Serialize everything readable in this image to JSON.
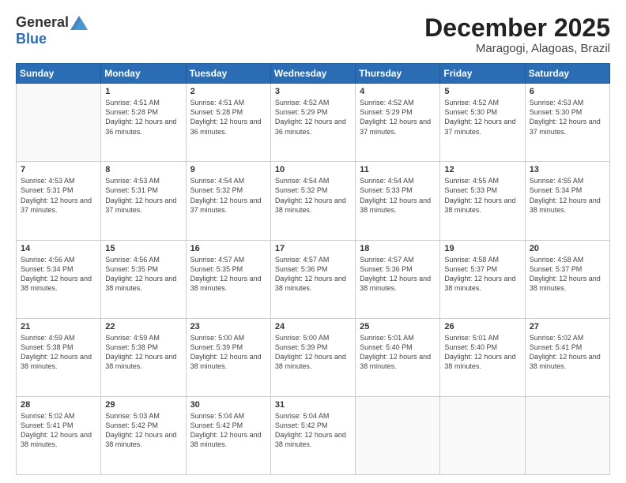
{
  "logo": {
    "general": "General",
    "blue": "Blue"
  },
  "title": {
    "month": "December 2025",
    "location": "Maragogi, Alagoas, Brazil"
  },
  "header": {
    "days": [
      "Sunday",
      "Monday",
      "Tuesday",
      "Wednesday",
      "Thursday",
      "Friday",
      "Saturday"
    ]
  },
  "weeks": [
    [
      {
        "day": "",
        "sunrise": "",
        "sunset": "",
        "daylight": ""
      },
      {
        "day": "1",
        "sunrise": "Sunrise: 4:51 AM",
        "sunset": "Sunset: 5:28 PM",
        "daylight": "Daylight: 12 hours and 36 minutes."
      },
      {
        "day": "2",
        "sunrise": "Sunrise: 4:51 AM",
        "sunset": "Sunset: 5:28 PM",
        "daylight": "Daylight: 12 hours and 36 minutes."
      },
      {
        "day": "3",
        "sunrise": "Sunrise: 4:52 AM",
        "sunset": "Sunset: 5:29 PM",
        "daylight": "Daylight: 12 hours and 36 minutes."
      },
      {
        "day": "4",
        "sunrise": "Sunrise: 4:52 AM",
        "sunset": "Sunset: 5:29 PM",
        "daylight": "Daylight: 12 hours and 37 minutes."
      },
      {
        "day": "5",
        "sunrise": "Sunrise: 4:52 AM",
        "sunset": "Sunset: 5:30 PM",
        "daylight": "Daylight: 12 hours and 37 minutes."
      },
      {
        "day": "6",
        "sunrise": "Sunrise: 4:53 AM",
        "sunset": "Sunset: 5:30 PM",
        "daylight": "Daylight: 12 hours and 37 minutes."
      }
    ],
    [
      {
        "day": "7",
        "sunrise": "Sunrise: 4:53 AM",
        "sunset": "Sunset: 5:31 PM",
        "daylight": "Daylight: 12 hours and 37 minutes."
      },
      {
        "day": "8",
        "sunrise": "Sunrise: 4:53 AM",
        "sunset": "Sunset: 5:31 PM",
        "daylight": "Daylight: 12 hours and 37 minutes."
      },
      {
        "day": "9",
        "sunrise": "Sunrise: 4:54 AM",
        "sunset": "Sunset: 5:32 PM",
        "daylight": "Daylight: 12 hours and 37 minutes."
      },
      {
        "day": "10",
        "sunrise": "Sunrise: 4:54 AM",
        "sunset": "Sunset: 5:32 PM",
        "daylight": "Daylight: 12 hours and 38 minutes."
      },
      {
        "day": "11",
        "sunrise": "Sunrise: 4:54 AM",
        "sunset": "Sunset: 5:33 PM",
        "daylight": "Daylight: 12 hours and 38 minutes."
      },
      {
        "day": "12",
        "sunrise": "Sunrise: 4:55 AM",
        "sunset": "Sunset: 5:33 PM",
        "daylight": "Daylight: 12 hours and 38 minutes."
      },
      {
        "day": "13",
        "sunrise": "Sunrise: 4:55 AM",
        "sunset": "Sunset: 5:34 PM",
        "daylight": "Daylight: 12 hours and 38 minutes."
      }
    ],
    [
      {
        "day": "14",
        "sunrise": "Sunrise: 4:56 AM",
        "sunset": "Sunset: 5:34 PM",
        "daylight": "Daylight: 12 hours and 38 minutes."
      },
      {
        "day": "15",
        "sunrise": "Sunrise: 4:56 AM",
        "sunset": "Sunset: 5:35 PM",
        "daylight": "Daylight: 12 hours and 38 minutes."
      },
      {
        "day": "16",
        "sunrise": "Sunrise: 4:57 AM",
        "sunset": "Sunset: 5:35 PM",
        "daylight": "Daylight: 12 hours and 38 minutes."
      },
      {
        "day": "17",
        "sunrise": "Sunrise: 4:57 AM",
        "sunset": "Sunset: 5:36 PM",
        "daylight": "Daylight: 12 hours and 38 minutes."
      },
      {
        "day": "18",
        "sunrise": "Sunrise: 4:57 AM",
        "sunset": "Sunset: 5:36 PM",
        "daylight": "Daylight: 12 hours and 38 minutes."
      },
      {
        "day": "19",
        "sunrise": "Sunrise: 4:58 AM",
        "sunset": "Sunset: 5:37 PM",
        "daylight": "Daylight: 12 hours and 38 minutes."
      },
      {
        "day": "20",
        "sunrise": "Sunrise: 4:58 AM",
        "sunset": "Sunset: 5:37 PM",
        "daylight": "Daylight: 12 hours and 38 minutes."
      }
    ],
    [
      {
        "day": "21",
        "sunrise": "Sunrise: 4:59 AM",
        "sunset": "Sunset: 5:38 PM",
        "daylight": "Daylight: 12 hours and 38 minutes."
      },
      {
        "day": "22",
        "sunrise": "Sunrise: 4:59 AM",
        "sunset": "Sunset: 5:38 PM",
        "daylight": "Daylight: 12 hours and 38 minutes."
      },
      {
        "day": "23",
        "sunrise": "Sunrise: 5:00 AM",
        "sunset": "Sunset: 5:39 PM",
        "daylight": "Daylight: 12 hours and 38 minutes."
      },
      {
        "day": "24",
        "sunrise": "Sunrise: 5:00 AM",
        "sunset": "Sunset: 5:39 PM",
        "daylight": "Daylight: 12 hours and 38 minutes."
      },
      {
        "day": "25",
        "sunrise": "Sunrise: 5:01 AM",
        "sunset": "Sunset: 5:40 PM",
        "daylight": "Daylight: 12 hours and 38 minutes."
      },
      {
        "day": "26",
        "sunrise": "Sunrise: 5:01 AM",
        "sunset": "Sunset: 5:40 PM",
        "daylight": "Daylight: 12 hours and 38 minutes."
      },
      {
        "day": "27",
        "sunrise": "Sunrise: 5:02 AM",
        "sunset": "Sunset: 5:41 PM",
        "daylight": "Daylight: 12 hours and 38 minutes."
      }
    ],
    [
      {
        "day": "28",
        "sunrise": "Sunrise: 5:02 AM",
        "sunset": "Sunset: 5:41 PM",
        "daylight": "Daylight: 12 hours and 38 minutes."
      },
      {
        "day": "29",
        "sunrise": "Sunrise: 5:03 AM",
        "sunset": "Sunset: 5:42 PM",
        "daylight": "Daylight: 12 hours and 38 minutes."
      },
      {
        "day": "30",
        "sunrise": "Sunrise: 5:04 AM",
        "sunset": "Sunset: 5:42 PM",
        "daylight": "Daylight: 12 hours and 38 minutes."
      },
      {
        "day": "31",
        "sunrise": "Sunrise: 5:04 AM",
        "sunset": "Sunset: 5:42 PM",
        "daylight": "Daylight: 12 hours and 38 minutes."
      },
      {
        "day": "",
        "sunrise": "",
        "sunset": "",
        "daylight": ""
      },
      {
        "day": "",
        "sunrise": "",
        "sunset": "",
        "daylight": ""
      },
      {
        "day": "",
        "sunrise": "",
        "sunset": "",
        "daylight": ""
      }
    ]
  ]
}
